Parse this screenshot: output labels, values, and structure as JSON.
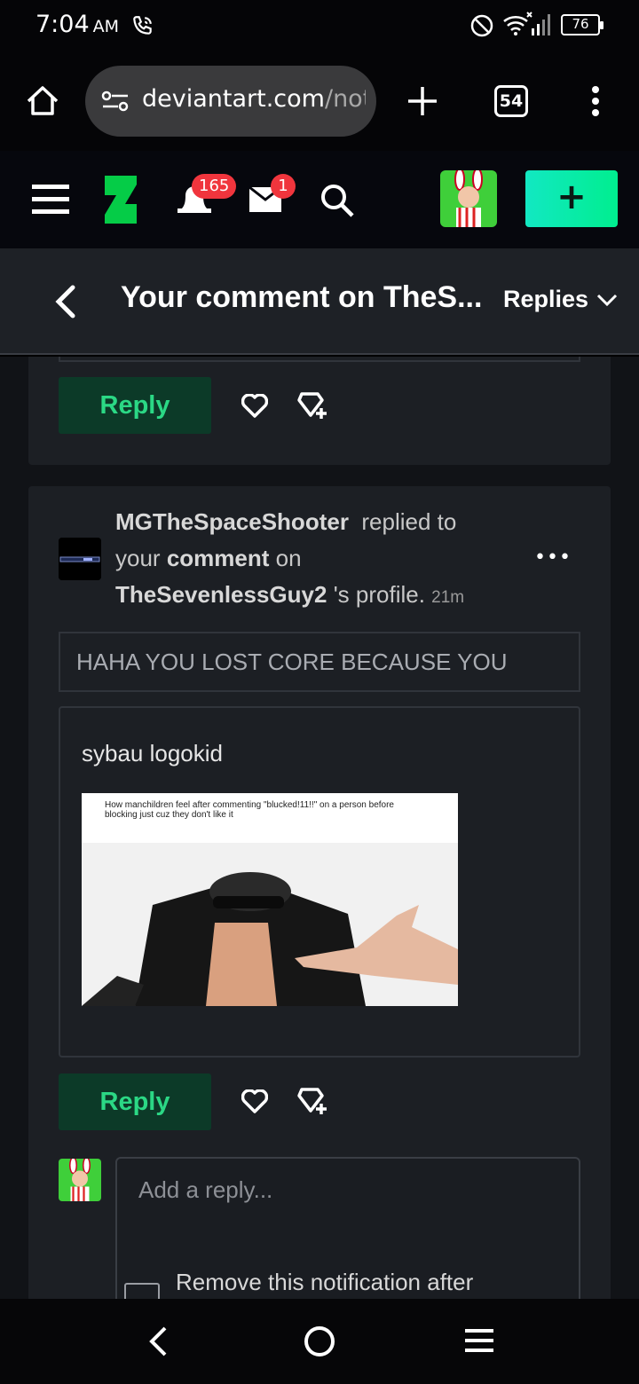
{
  "status": {
    "time": "7:04",
    "ampm": "AM",
    "battery": "76"
  },
  "browser": {
    "url_domain": "deviantart.com",
    "url_path": "/notif",
    "tab_count": "54"
  },
  "nav": {
    "notifications_badge": "165",
    "messages_badge": "1",
    "brand_color": "#05cc47",
    "create_label": "+"
  },
  "header": {
    "title": "Your comment on TheS...",
    "replies_label": "Replies"
  },
  "prev_comment": {
    "reply_label": "Reply"
  },
  "comment": {
    "username": "MGTheSpaceShooter",
    "replied_to": "replied to",
    "your": "your",
    "comment_word": "comment",
    "on": "on",
    "target": "TheSevenlessGuy2",
    "profile_suffix": "'s profile.",
    "time_ago": "21m",
    "more_label": "•••",
    "quoted": "HAHA YOU LOST CORE BECAUSE YOU",
    "body": "sybau logokid",
    "image_caption": "How manchildren feel after commenting \"blucked!11!!\" on a person before blocking just cuz they don't like it",
    "reply_label": "Reply"
  },
  "reply_box": {
    "placeholder": "Add a reply...",
    "remove_label": "Remove this notification after"
  }
}
